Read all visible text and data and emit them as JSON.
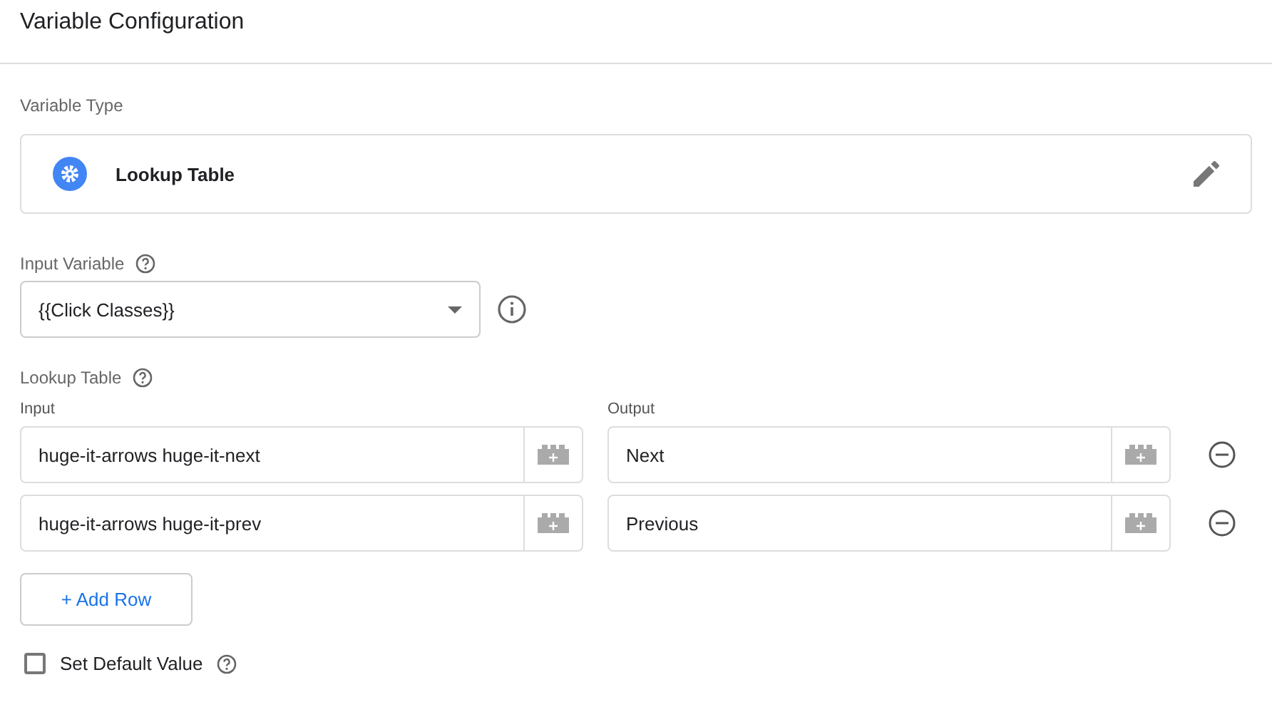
{
  "header": {
    "title": "Variable Configuration"
  },
  "variable_type": {
    "label": "Variable Type",
    "value": "Lookup Table"
  },
  "input_variable": {
    "label": "Input Variable",
    "value": "{{Click Classes}}"
  },
  "lookup_table": {
    "label": "Lookup Table",
    "columns": [
      "Input",
      "Output"
    ],
    "rows": [
      {
        "input": "huge-it-arrows huge-it-next",
        "output": "Next"
      },
      {
        "input": "huge-it-arrows huge-it-prev",
        "output": "Previous"
      }
    ]
  },
  "add_row_button": "+ Add Row",
  "default_value": {
    "label": "Set Default Value",
    "checked": false
  }
}
